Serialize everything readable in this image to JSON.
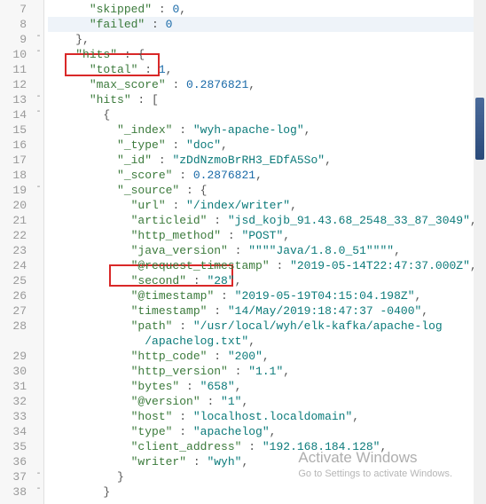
{
  "lines": [
    {
      "n": "7",
      "fold": "",
      "indent": "      ",
      "parts": [
        {
          "t": "\"skipped\"",
          "c": "key"
        },
        {
          "t": " : ",
          "c": "pun"
        },
        {
          "t": "0",
          "c": "num"
        },
        {
          "t": ",",
          "c": "pun"
        }
      ]
    },
    {
      "n": "8",
      "fold": "",
      "indent": "      ",
      "hl": true,
      "parts": [
        {
          "t": "\"failed\"",
          "c": "key"
        },
        {
          "t": " : ",
          "c": "pun"
        },
        {
          "t": "0",
          "c": "num"
        }
      ]
    },
    {
      "n": "9",
      "fold": "-",
      "indent": "    ",
      "parts": [
        {
          "t": "},",
          "c": "brace"
        }
      ]
    },
    {
      "n": "10",
      "fold": "-",
      "indent": "    ",
      "parts": [
        {
          "t": "\"hits\"",
          "c": "key"
        },
        {
          "t": " : {",
          "c": "brace"
        }
      ]
    },
    {
      "n": "11",
      "fold": "",
      "indent": "      ",
      "parts": [
        {
          "t": "\"total\"",
          "c": "key"
        },
        {
          "t": " : ",
          "c": "pun"
        },
        {
          "t": "1",
          "c": "num"
        },
        {
          "t": ",",
          "c": "pun"
        }
      ]
    },
    {
      "n": "12",
      "fold": "",
      "indent": "      ",
      "parts": [
        {
          "t": "\"max_score\"",
          "c": "key"
        },
        {
          "t": " : ",
          "c": "pun"
        },
        {
          "t": "0.2876821",
          "c": "num"
        },
        {
          "t": ",",
          "c": "pun"
        }
      ]
    },
    {
      "n": "13",
      "fold": "-",
      "indent": "      ",
      "parts": [
        {
          "t": "\"hits\"",
          "c": "key"
        },
        {
          "t": " : [",
          "c": "brace"
        }
      ]
    },
    {
      "n": "14",
      "fold": "-",
      "indent": "        ",
      "parts": [
        {
          "t": "{",
          "c": "brace"
        }
      ]
    },
    {
      "n": "15",
      "fold": "",
      "indent": "          ",
      "parts": [
        {
          "t": "\"_index\"",
          "c": "key"
        },
        {
          "t": " : ",
          "c": "pun"
        },
        {
          "t": "\"wyh-apache-log\"",
          "c": "str"
        },
        {
          "t": ",",
          "c": "pun"
        }
      ]
    },
    {
      "n": "16",
      "fold": "",
      "indent": "          ",
      "parts": [
        {
          "t": "\"_type\"",
          "c": "key"
        },
        {
          "t": " : ",
          "c": "pun"
        },
        {
          "t": "\"doc\"",
          "c": "str"
        },
        {
          "t": ",",
          "c": "pun"
        }
      ]
    },
    {
      "n": "17",
      "fold": "",
      "indent": "          ",
      "parts": [
        {
          "t": "\"_id\"",
          "c": "key"
        },
        {
          "t": " : ",
          "c": "pun"
        },
        {
          "t": "\"zDdNzmoBrRH3_EDfA5So\"",
          "c": "str"
        },
        {
          "t": ",",
          "c": "pun"
        }
      ]
    },
    {
      "n": "18",
      "fold": "",
      "indent": "          ",
      "parts": [
        {
          "t": "\"_score\"",
          "c": "key"
        },
        {
          "t": " : ",
          "c": "pun"
        },
        {
          "t": "0.2876821",
          "c": "num"
        },
        {
          "t": ",",
          "c": "pun"
        }
      ]
    },
    {
      "n": "19",
      "fold": "-",
      "indent": "          ",
      "parts": [
        {
          "t": "\"_source\"",
          "c": "key"
        },
        {
          "t": " : {",
          "c": "brace"
        }
      ]
    },
    {
      "n": "20",
      "fold": "",
      "indent": "            ",
      "parts": [
        {
          "t": "\"url\"",
          "c": "key"
        },
        {
          "t": " : ",
          "c": "pun"
        },
        {
          "t": "\"/index/writer\"",
          "c": "str"
        },
        {
          "t": ",",
          "c": "pun"
        }
      ]
    },
    {
      "n": "21",
      "fold": "",
      "indent": "            ",
      "parts": [
        {
          "t": "\"articleid\"",
          "c": "key"
        },
        {
          "t": " : ",
          "c": "pun"
        },
        {
          "t": "\"jsd_kojb_91.43.68_2548_33_87_3049\"",
          "c": "str"
        },
        {
          "t": ",",
          "c": "pun"
        }
      ]
    },
    {
      "n": "22",
      "fold": "",
      "indent": "            ",
      "parts": [
        {
          "t": "\"http_method\"",
          "c": "key"
        },
        {
          "t": " : ",
          "c": "pun"
        },
        {
          "t": "\"POST\"",
          "c": "str"
        },
        {
          "t": ",",
          "c": "pun"
        }
      ]
    },
    {
      "n": "23",
      "fold": "",
      "indent": "            ",
      "parts": [
        {
          "t": "\"java_version\"",
          "c": "key"
        },
        {
          "t": " : ",
          "c": "pun"
        },
        {
          "t": "\"\"\"\"Java/1.8.0_51\"\"\"\"",
          "c": "str"
        },
        {
          "t": ",",
          "c": "pun"
        }
      ]
    },
    {
      "n": "24",
      "fold": "",
      "indent": "            ",
      "parts": [
        {
          "t": "\"@request_timestamp\"",
          "c": "key"
        },
        {
          "t": " : ",
          "c": "pun"
        },
        {
          "t": "\"2019-05-14T22:47:37.000Z\"",
          "c": "str"
        },
        {
          "t": ",",
          "c": "pun"
        }
      ]
    },
    {
      "n": "25",
      "fold": "",
      "indent": "            ",
      "parts": [
        {
          "t": "\"second\"",
          "c": "key"
        },
        {
          "t": " : ",
          "c": "pun"
        },
        {
          "t": "\"28\"",
          "c": "str"
        },
        {
          "t": ",",
          "c": "pun"
        }
      ]
    },
    {
      "n": "26",
      "fold": "",
      "indent": "            ",
      "parts": [
        {
          "t": "\"@timestamp\"",
          "c": "key"
        },
        {
          "t": " : ",
          "c": "pun"
        },
        {
          "t": "\"2019-05-19T04:15:04.198Z\"",
          "c": "str"
        },
        {
          "t": ",",
          "c": "pun"
        }
      ]
    },
    {
      "n": "27",
      "fold": "",
      "indent": "            ",
      "parts": [
        {
          "t": "\"timestamp\"",
          "c": "key"
        },
        {
          "t": " : ",
          "c": "pun"
        },
        {
          "t": "\"14/May/2019:18:47:37 -0400\"",
          "c": "str"
        },
        {
          "t": ",",
          "c": "pun"
        }
      ]
    },
    {
      "n": "28",
      "fold": "",
      "indent": "            ",
      "parts": [
        {
          "t": "\"path\"",
          "c": "key"
        },
        {
          "t": " : ",
          "c": "pun"
        },
        {
          "t": "\"/usr/local/wyh/elk-kafka/apache-log",
          "c": "str"
        }
      ]
    },
    {
      "n": "",
      "fold": "",
      "indent": "              ",
      "parts": [
        {
          "t": "/apachelog.txt\"",
          "c": "str"
        },
        {
          "t": ",",
          "c": "pun"
        }
      ]
    },
    {
      "n": "29",
      "fold": "",
      "indent": "            ",
      "parts": [
        {
          "t": "\"http_code\"",
          "c": "key"
        },
        {
          "t": " : ",
          "c": "pun"
        },
        {
          "t": "\"200\"",
          "c": "str"
        },
        {
          "t": ",",
          "c": "pun"
        }
      ]
    },
    {
      "n": "30",
      "fold": "",
      "indent": "            ",
      "parts": [
        {
          "t": "\"http_version\"",
          "c": "key"
        },
        {
          "t": " : ",
          "c": "pun"
        },
        {
          "t": "\"1.1\"",
          "c": "str"
        },
        {
          "t": ",",
          "c": "pun"
        }
      ]
    },
    {
      "n": "31",
      "fold": "",
      "indent": "            ",
      "parts": [
        {
          "t": "\"bytes\"",
          "c": "key"
        },
        {
          "t": " : ",
          "c": "pun"
        },
        {
          "t": "\"658\"",
          "c": "str"
        },
        {
          "t": ",",
          "c": "pun"
        }
      ]
    },
    {
      "n": "32",
      "fold": "",
      "indent": "            ",
      "parts": [
        {
          "t": "\"@version\"",
          "c": "key"
        },
        {
          "t": " : ",
          "c": "pun"
        },
        {
          "t": "\"1\"",
          "c": "str"
        },
        {
          "t": ",",
          "c": "pun"
        }
      ]
    },
    {
      "n": "33",
      "fold": "",
      "indent": "            ",
      "parts": [
        {
          "t": "\"host\"",
          "c": "key"
        },
        {
          "t": " : ",
          "c": "pun"
        },
        {
          "t": "\"localhost.localdomain\"",
          "c": "str"
        },
        {
          "t": ",",
          "c": "pun"
        }
      ]
    },
    {
      "n": "34",
      "fold": "",
      "indent": "            ",
      "parts": [
        {
          "t": "\"type\"",
          "c": "key"
        },
        {
          "t": " : ",
          "c": "pun"
        },
        {
          "t": "\"apachelog\"",
          "c": "str"
        },
        {
          "t": ",",
          "c": "pun"
        }
      ]
    },
    {
      "n": "35",
      "fold": "",
      "indent": "            ",
      "parts": [
        {
          "t": "\"client_address\"",
          "c": "key"
        },
        {
          "t": " : ",
          "c": "pun"
        },
        {
          "t": "\"192.168.184.128\"",
          "c": "str"
        },
        {
          "t": ",",
          "c": "pun"
        }
      ]
    },
    {
      "n": "36",
      "fold": "",
      "indent": "            ",
      "parts": [
        {
          "t": "\"writer\"",
          "c": "key"
        },
        {
          "t": " : ",
          "c": "pun"
        },
        {
          "t": "\"wyh\"",
          "c": "str"
        },
        {
          "t": ",",
          "c": "pun"
        }
      ]
    },
    {
      "n": "37",
      "fold": "-",
      "indent": "          ",
      "parts": [
        {
          "t": "}",
          "c": "brace"
        }
      ]
    },
    {
      "n": "38",
      "fold": "-",
      "indent": "        ",
      "parts": [
        {
          "t": "}",
          "c": "brace"
        }
      ]
    }
  ],
  "watermark": {
    "title": "Activate Windows",
    "sub": "Go to Settings to activate Windows."
  }
}
